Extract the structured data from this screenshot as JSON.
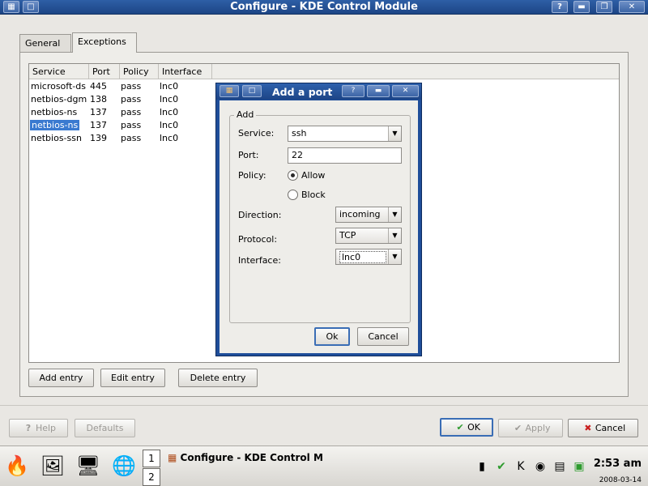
{
  "window": {
    "title": "Configure - KDE Control Module"
  },
  "tabs": [
    {
      "label": "General",
      "active": false
    },
    {
      "label": "Exceptions",
      "active": true
    }
  ],
  "list": {
    "columns": [
      "Service",
      "Port",
      "Policy",
      "Interface"
    ],
    "rows": [
      {
        "service": "microsoft-ds",
        "port": "445",
        "policy": "pass",
        "interface": "lnc0",
        "selected": false
      },
      {
        "service": "netbios-dgm",
        "port": "138",
        "policy": "pass",
        "interface": "lnc0",
        "selected": false
      },
      {
        "service": "netbios-ns",
        "port": "137",
        "policy": "pass",
        "interface": "lnc0",
        "selected": false
      },
      {
        "service": "netbios-ns",
        "port": "137",
        "policy": "pass",
        "interface": "lnc0",
        "selected": true
      },
      {
        "service": "netbios-ssn",
        "port": "139",
        "policy": "pass",
        "interface": "lnc0",
        "selected": false
      }
    ]
  },
  "entry_buttons": {
    "add": "Add entry",
    "edit": "Edit entry",
    "delete": "Delete entry"
  },
  "dialog": {
    "title": "Add a port",
    "group_title": "Add",
    "service_label": "Service:",
    "service_value": "ssh",
    "port_label": "Port:",
    "port_value": "22",
    "policy_label": "Policy:",
    "policy_options": [
      {
        "label": "Allow",
        "checked": true
      },
      {
        "label": "Block",
        "checked": false
      }
    ],
    "direction_label": "Direction:",
    "direction_value": "incoming",
    "protocol_label": "Protocol:",
    "protocol_value": "TCP",
    "interface_label": "Interface:",
    "interface_value": "lnc0",
    "ok_label": "Ok",
    "cancel_label": "Cancel"
  },
  "bottom_buttons": {
    "help": "Help",
    "defaults": "Defaults",
    "ok": "OK",
    "apply": "Apply",
    "cancel": "Cancel"
  },
  "taskbar": {
    "desktops": [
      "1",
      "2"
    ],
    "task_title": "Configure - KDE Control M",
    "clock_time": "2:53 am",
    "clock_date": "2008-03-14"
  },
  "colors": {
    "titlebar": "#1d4585",
    "selection": "#3a7ad0",
    "dialog_frame": "#1f4e9a"
  }
}
